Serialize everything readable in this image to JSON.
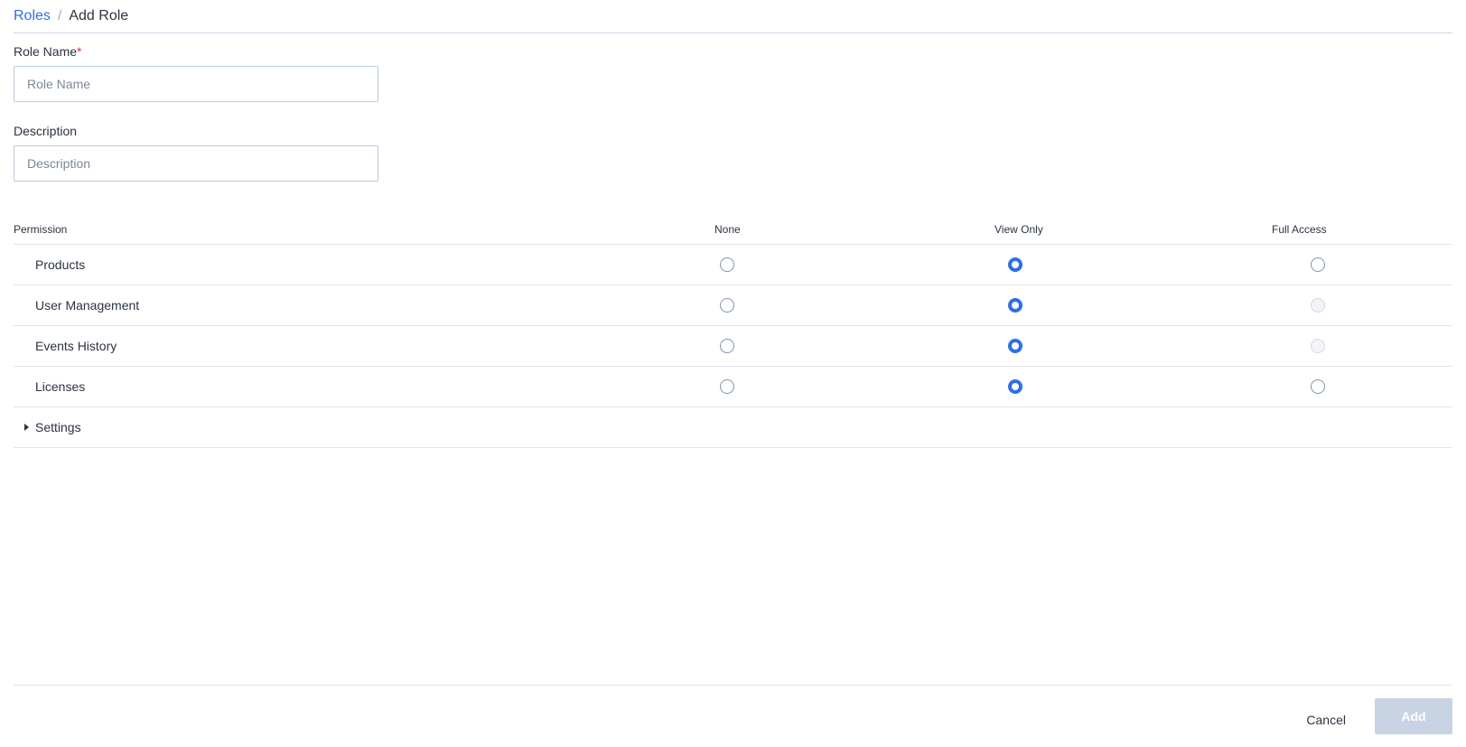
{
  "breadcrumb": {
    "parent": "Roles",
    "separator": "/",
    "current": "Add Role"
  },
  "form": {
    "role_name": {
      "label": "Role Name",
      "required_mark": "*",
      "value": "",
      "placeholder": "Role Name"
    },
    "description": {
      "label": "Description",
      "value": "",
      "placeholder": "Description"
    }
  },
  "permissions": {
    "headers": {
      "name": "Permission",
      "none": "None",
      "view": "View Only",
      "full": "Full Access"
    },
    "rows": [
      {
        "label": "Products",
        "selected": "View Only",
        "full_access_disabled": false
      },
      {
        "label": "User Management",
        "selected": "View Only",
        "full_access_disabled": true
      },
      {
        "label": "Events History",
        "selected": "View Only",
        "full_access_disabled": true
      },
      {
        "label": "Licenses",
        "selected": "View Only",
        "full_access_disabled": false
      }
    ],
    "settings": {
      "label": "Settings",
      "expanded": false,
      "icon": "caret-right-icon"
    }
  },
  "footer": {
    "cancel_label": "Cancel",
    "add_label": "Add",
    "add_disabled": true
  },
  "colors": {
    "accent": "#2f6fe4",
    "required": "#e0243f",
    "disabled_button": "#c8d4e4"
  }
}
